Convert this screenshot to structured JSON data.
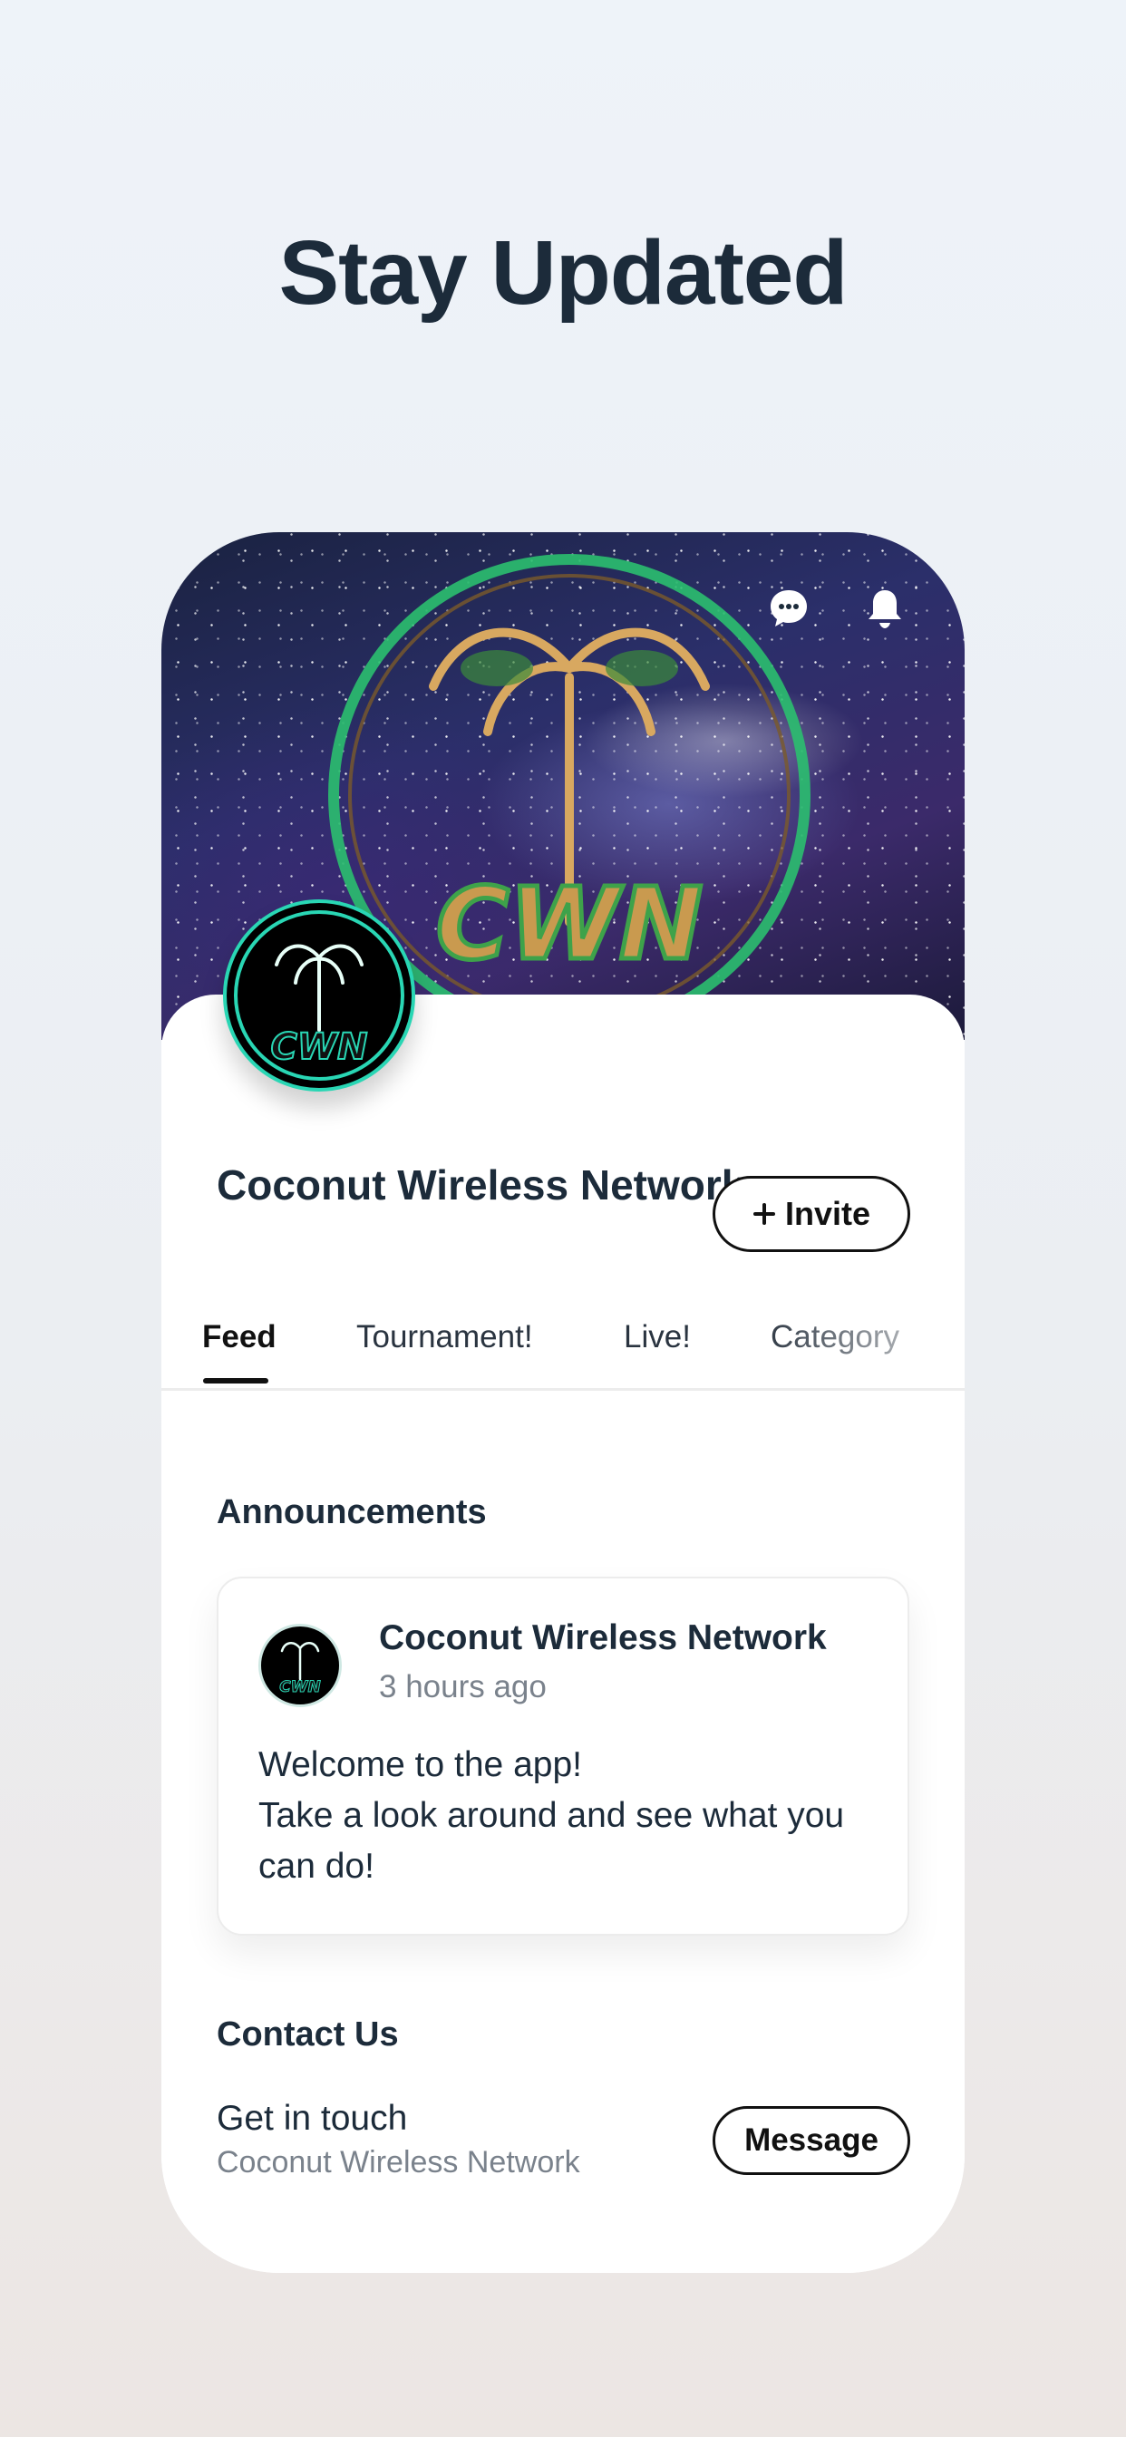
{
  "headline": "Stay Updated",
  "site": {
    "name": "Coconut Wireless Network",
    "logo_text": "CWN",
    "accent_color": "#29d6b4"
  },
  "header_icons": [
    "chat-icon",
    "bell-icon"
  ],
  "actions": {
    "invite_label": "Invite",
    "invite_icon": "plus-icon"
  },
  "tabs": [
    {
      "label": "Feed",
      "active": true
    },
    {
      "label": "Tournament!",
      "active": false
    },
    {
      "label": "Live!",
      "active": false
    },
    {
      "label": "Category",
      "active": false
    }
  ],
  "announcements": {
    "title": "Announcements",
    "post": {
      "author": "Coconut Wireless Network",
      "time": "3 hours ago",
      "body_line1": "Welcome to the app!",
      "body_line2": "Take a look around and see what you can do!"
    }
  },
  "contact": {
    "title": "Contact Us",
    "label": "Get in touch",
    "sub": "Coconut Wireless Network",
    "button_label": "Message"
  }
}
